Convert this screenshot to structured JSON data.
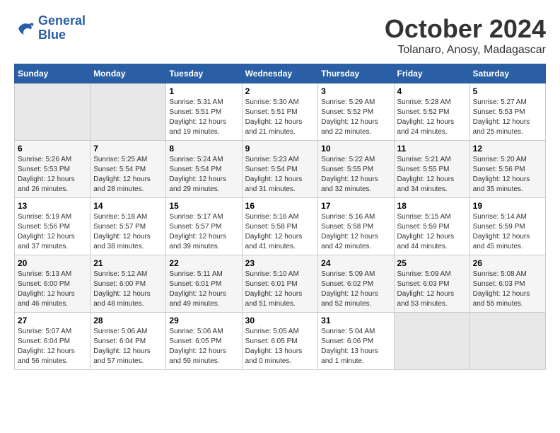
{
  "logo": {
    "line1": "General",
    "line2": "Blue"
  },
  "title": "October 2024",
  "location": "Tolanaro, Anosy, Madagascar",
  "weekdays": [
    "Sunday",
    "Monday",
    "Tuesday",
    "Wednesday",
    "Thursday",
    "Friday",
    "Saturday"
  ],
  "weeks": [
    [
      {
        "day": "",
        "sunrise": "",
        "sunset": "",
        "daylight": ""
      },
      {
        "day": "",
        "sunrise": "",
        "sunset": "",
        "daylight": ""
      },
      {
        "day": "1",
        "sunrise": "Sunrise: 5:31 AM",
        "sunset": "Sunset: 5:51 PM",
        "daylight": "Daylight: 12 hours and 19 minutes."
      },
      {
        "day": "2",
        "sunrise": "Sunrise: 5:30 AM",
        "sunset": "Sunset: 5:51 PM",
        "daylight": "Daylight: 12 hours and 21 minutes."
      },
      {
        "day": "3",
        "sunrise": "Sunrise: 5:29 AM",
        "sunset": "Sunset: 5:52 PM",
        "daylight": "Daylight: 12 hours and 22 minutes."
      },
      {
        "day": "4",
        "sunrise": "Sunrise: 5:28 AM",
        "sunset": "Sunset: 5:52 PM",
        "daylight": "Daylight: 12 hours and 24 minutes."
      },
      {
        "day": "5",
        "sunrise": "Sunrise: 5:27 AM",
        "sunset": "Sunset: 5:53 PM",
        "daylight": "Daylight: 12 hours and 25 minutes."
      }
    ],
    [
      {
        "day": "6",
        "sunrise": "Sunrise: 5:26 AM",
        "sunset": "Sunset: 5:53 PM",
        "daylight": "Daylight: 12 hours and 26 minutes."
      },
      {
        "day": "7",
        "sunrise": "Sunrise: 5:25 AM",
        "sunset": "Sunset: 5:54 PM",
        "daylight": "Daylight: 12 hours and 28 minutes."
      },
      {
        "day": "8",
        "sunrise": "Sunrise: 5:24 AM",
        "sunset": "Sunset: 5:54 PM",
        "daylight": "Daylight: 12 hours and 29 minutes."
      },
      {
        "day": "9",
        "sunrise": "Sunrise: 5:23 AM",
        "sunset": "Sunset: 5:54 PM",
        "daylight": "Daylight: 12 hours and 31 minutes."
      },
      {
        "day": "10",
        "sunrise": "Sunrise: 5:22 AM",
        "sunset": "Sunset: 5:55 PM",
        "daylight": "Daylight: 12 hours and 32 minutes."
      },
      {
        "day": "11",
        "sunrise": "Sunrise: 5:21 AM",
        "sunset": "Sunset: 5:55 PM",
        "daylight": "Daylight: 12 hours and 34 minutes."
      },
      {
        "day": "12",
        "sunrise": "Sunrise: 5:20 AM",
        "sunset": "Sunset: 5:56 PM",
        "daylight": "Daylight: 12 hours and 35 minutes."
      }
    ],
    [
      {
        "day": "13",
        "sunrise": "Sunrise: 5:19 AM",
        "sunset": "Sunset: 5:56 PM",
        "daylight": "Daylight: 12 hours and 37 minutes."
      },
      {
        "day": "14",
        "sunrise": "Sunrise: 5:18 AM",
        "sunset": "Sunset: 5:57 PM",
        "daylight": "Daylight: 12 hours and 38 minutes."
      },
      {
        "day": "15",
        "sunrise": "Sunrise: 5:17 AM",
        "sunset": "Sunset: 5:57 PM",
        "daylight": "Daylight: 12 hours and 39 minutes."
      },
      {
        "day": "16",
        "sunrise": "Sunrise: 5:16 AM",
        "sunset": "Sunset: 5:58 PM",
        "daylight": "Daylight: 12 hours and 41 minutes."
      },
      {
        "day": "17",
        "sunrise": "Sunrise: 5:16 AM",
        "sunset": "Sunset: 5:58 PM",
        "daylight": "Daylight: 12 hours and 42 minutes."
      },
      {
        "day": "18",
        "sunrise": "Sunrise: 5:15 AM",
        "sunset": "Sunset: 5:59 PM",
        "daylight": "Daylight: 12 hours and 44 minutes."
      },
      {
        "day": "19",
        "sunrise": "Sunrise: 5:14 AM",
        "sunset": "Sunset: 5:59 PM",
        "daylight": "Daylight: 12 hours and 45 minutes."
      }
    ],
    [
      {
        "day": "20",
        "sunrise": "Sunrise: 5:13 AM",
        "sunset": "Sunset: 6:00 PM",
        "daylight": "Daylight: 12 hours and 46 minutes."
      },
      {
        "day": "21",
        "sunrise": "Sunrise: 5:12 AM",
        "sunset": "Sunset: 6:00 PM",
        "daylight": "Daylight: 12 hours and 48 minutes."
      },
      {
        "day": "22",
        "sunrise": "Sunrise: 5:11 AM",
        "sunset": "Sunset: 6:01 PM",
        "daylight": "Daylight: 12 hours and 49 minutes."
      },
      {
        "day": "23",
        "sunrise": "Sunrise: 5:10 AM",
        "sunset": "Sunset: 6:01 PM",
        "daylight": "Daylight: 12 hours and 51 minutes."
      },
      {
        "day": "24",
        "sunrise": "Sunrise: 5:09 AM",
        "sunset": "Sunset: 6:02 PM",
        "daylight": "Daylight: 12 hours and 52 minutes."
      },
      {
        "day": "25",
        "sunrise": "Sunrise: 5:09 AM",
        "sunset": "Sunset: 6:03 PM",
        "daylight": "Daylight: 12 hours and 53 minutes."
      },
      {
        "day": "26",
        "sunrise": "Sunrise: 5:08 AM",
        "sunset": "Sunset: 6:03 PM",
        "daylight": "Daylight: 12 hours and 55 minutes."
      }
    ],
    [
      {
        "day": "27",
        "sunrise": "Sunrise: 5:07 AM",
        "sunset": "Sunset: 6:04 PM",
        "daylight": "Daylight: 12 hours and 56 minutes."
      },
      {
        "day": "28",
        "sunrise": "Sunrise: 5:06 AM",
        "sunset": "Sunset: 6:04 PM",
        "daylight": "Daylight: 12 hours and 57 minutes."
      },
      {
        "day": "29",
        "sunrise": "Sunrise: 5:06 AM",
        "sunset": "Sunset: 6:05 PM",
        "daylight": "Daylight: 12 hours and 59 minutes."
      },
      {
        "day": "30",
        "sunrise": "Sunrise: 5:05 AM",
        "sunset": "Sunset: 6:05 PM",
        "daylight": "Daylight: 13 hours and 0 minutes."
      },
      {
        "day": "31",
        "sunrise": "Sunrise: 5:04 AM",
        "sunset": "Sunset: 6:06 PM",
        "daylight": "Daylight: 13 hours and 1 minute."
      },
      {
        "day": "",
        "sunrise": "",
        "sunset": "",
        "daylight": ""
      },
      {
        "day": "",
        "sunrise": "",
        "sunset": "",
        "daylight": ""
      }
    ]
  ]
}
